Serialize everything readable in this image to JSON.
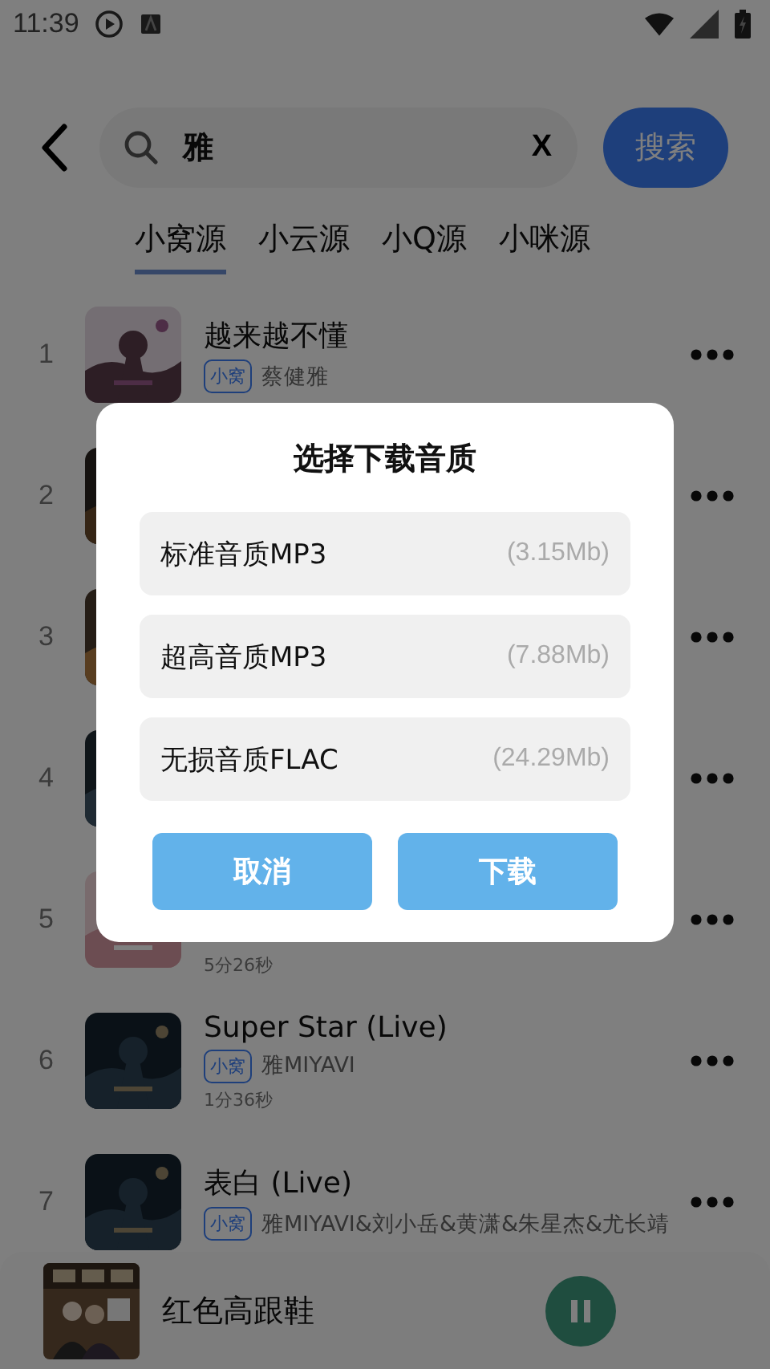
{
  "status_bar": {
    "time": "11:39"
  },
  "search": {
    "value": "雅",
    "clear": "X",
    "button": "搜索"
  },
  "tabs": [
    {
      "label": "小窝源",
      "selected": true
    },
    {
      "label": "小云源",
      "selected": false
    },
    {
      "label": "小Q源",
      "selected": false
    },
    {
      "label": "小咪源",
      "selected": false
    }
  ],
  "songs": [
    {
      "rank": "1",
      "title": "越来越不懂",
      "source": "小窝",
      "artist": "蔡健雅"
    },
    {
      "rank": "2"
    },
    {
      "rank": "3"
    },
    {
      "rank": "4"
    },
    {
      "rank": "5",
      "duration": "5分26秒"
    },
    {
      "rank": "6",
      "title": "Super Star (Live)",
      "source": "小窝",
      "artist": "雅MIYAVI",
      "duration": "1分36秒"
    },
    {
      "rank": "7",
      "title": "表白 (Live)",
      "source": "小窝",
      "artist": "雅MIYAVI&刘小岳&黄潇&朱星杰&尤长靖"
    }
  ],
  "dialog": {
    "title": "选择下载音质",
    "options": [
      {
        "label": "标准音质MP3",
        "size": "(3.15Mb)"
      },
      {
        "label": "超高音质MP3",
        "size": "(7.88Mb)"
      },
      {
        "label": "无损音质FLAC",
        "size": "(24.29Mb)"
      }
    ],
    "cancel": "取消",
    "confirm": "下载"
  },
  "player": {
    "title": "红色高跟鞋",
    "playing": true
  }
}
